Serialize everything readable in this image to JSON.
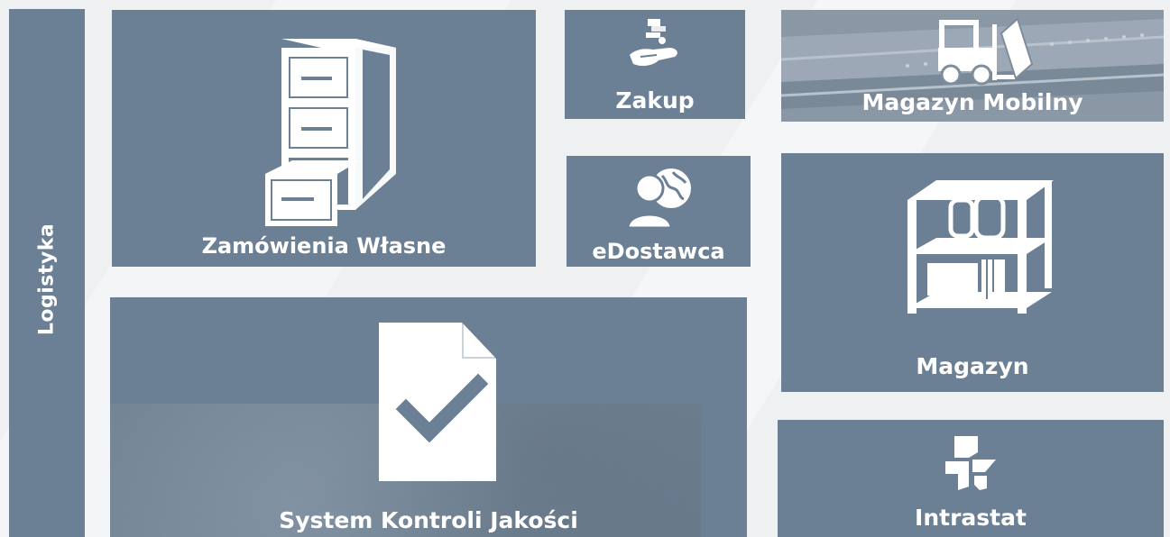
{
  "sidebar": {
    "label": "Logistyka"
  },
  "tiles": {
    "zamowienia": {
      "label": "Zamówienia Własne",
      "icon": "filing-cabinet-icon"
    },
    "zakup": {
      "label": "Zakup",
      "icon": "hand-money-icon"
    },
    "edostawca": {
      "label": "eDostawca",
      "icon": "person-globe-icon"
    },
    "magazyn_mobilny": {
      "label": "Magazyn Mobilny",
      "icon": "forklift-icon"
    },
    "magazyn": {
      "label": "Magazyn",
      "icon": "shelf-icon"
    },
    "skj": {
      "label": "System Kontroli Jakości",
      "icon": "document-check-icon"
    },
    "intrastat": {
      "label": "Intrastat",
      "icon": "intrastat-icon"
    }
  },
  "colors": {
    "tile": "#6b8094",
    "background": "#eef0f2",
    "text": "#ffffff"
  }
}
